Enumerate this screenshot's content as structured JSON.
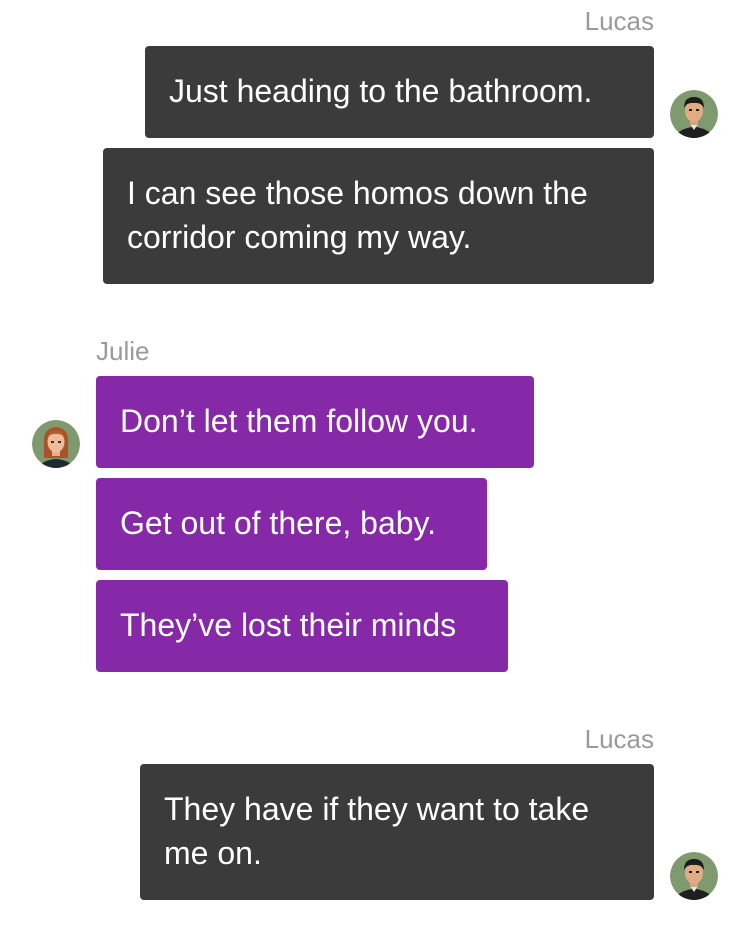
{
  "messages": [
    {
      "sender": "Lucas"
    },
    {
      "text": "Just heading to the bathroom."
    },
    {
      "text": "I can see those homos down the corridor coming my way."
    },
    {
      "sender": "Julie"
    },
    {
      "text": "Don’t let them follow you."
    },
    {
      "text": "Get out of there, baby."
    },
    {
      "text": "They’ve lost their minds"
    },
    {
      "sender": "Lucas"
    },
    {
      "text": "They have if they want to take me on."
    }
  ],
  "colors": {
    "outgoing_bubble": "#3b3b3b",
    "incoming_bubble": "#8529a8",
    "sender_name": "#9a9a9a"
  },
  "avatars": {
    "lucas": "male-avatar-icon",
    "julie": "female-avatar-icon"
  }
}
